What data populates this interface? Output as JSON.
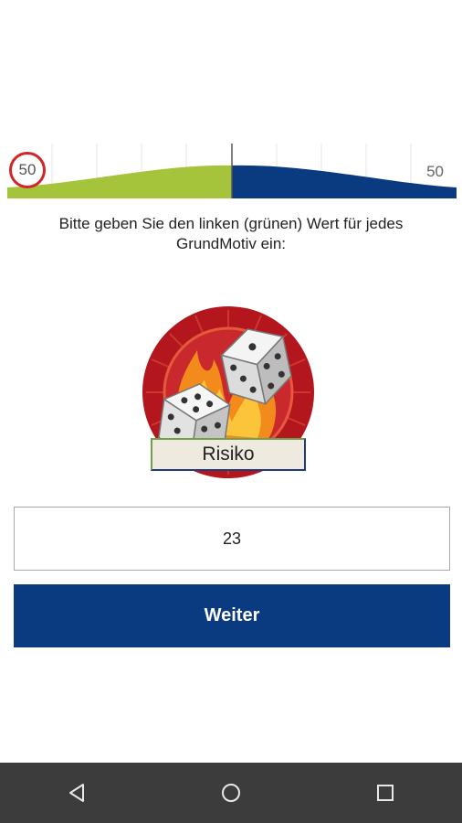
{
  "scale": {
    "left_value": "50",
    "right_value": "50",
    "left_color": "#a5c43c",
    "right_color": "#0a3a7f"
  },
  "instruction": "Bitte geben Sie den linken (grünen) Wert für jedes GrundMotiv ein:",
  "motive": {
    "icon": "dice-flames-icon",
    "label": "Risiko"
  },
  "input": {
    "value": "23"
  },
  "button": {
    "label": "Weiter",
    "color": "#0a3a7f"
  },
  "navbar": {
    "back": "back-icon",
    "home": "home-icon",
    "recents": "recents-icon"
  }
}
